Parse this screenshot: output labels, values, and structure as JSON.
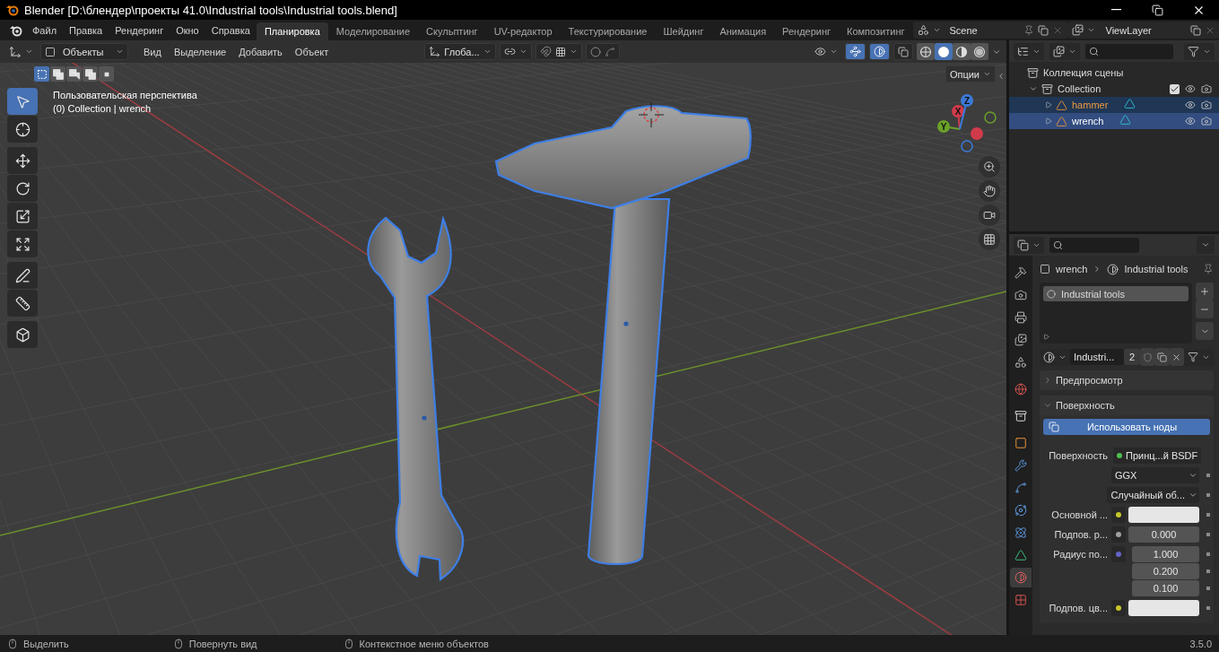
{
  "title_bar": {
    "title": "Blender [D:\\блендер\\проекты 41.0\\Industrial tools\\Industrial tools.blend]"
  },
  "top_bar": {
    "menus": [
      "Файл",
      "Правка",
      "Рендеринг",
      "Окно",
      "Справка"
    ],
    "workspaces": [
      {
        "label": "Планировка",
        "selected": true
      },
      {
        "label": "Моделирование",
        "selected": false
      },
      {
        "label": "Скульптинг",
        "selected": false
      },
      {
        "label": "UV-редактор",
        "selected": false
      },
      {
        "label": "Текстурирование",
        "selected": false
      },
      {
        "label": "Шейдинг",
        "selected": false
      },
      {
        "label": "Анимация",
        "selected": false
      },
      {
        "label": "Рендеринг",
        "selected": false
      },
      {
        "label": "Композитинг",
        "selected": false
      }
    ],
    "scene": "Scene",
    "view_layer": "ViewLayer"
  },
  "viewport": {
    "mode": "Объекты",
    "menus": [
      "Вид",
      "Выделение",
      "Добавить",
      "Объект"
    ],
    "orientation": "Глоба...",
    "toggles": [
      {
        "kind": "gizmos",
        "on": true
      },
      {
        "kind": "overlays",
        "on": true
      },
      {
        "kind": "xray",
        "on": false
      }
    ],
    "shading_modes": [
      {
        "kind": "wireframe",
        "selected": false
      },
      {
        "kind": "solid",
        "selected": true
      },
      {
        "kind": "material",
        "selected": false
      },
      {
        "kind": "rendered",
        "selected": false
      }
    ],
    "select_modes": [
      {
        "kind": "new",
        "selected": true
      },
      {
        "kind": "extend",
        "selected": false
      },
      {
        "kind": "subtract",
        "selected": false
      },
      {
        "kind": "invert",
        "selected": false
      },
      {
        "kind": "intersect",
        "selected": false
      }
    ],
    "options": "Опции",
    "tool_groups": [
      [
        {
          "kind": "select_box",
          "selected": true
        },
        {
          "kind": "cursor",
          "selected": false
        }
      ],
      [
        {
          "kind": "move",
          "selected": false
        },
        {
          "kind": "rotate",
          "selected": false
        },
        {
          "kind": "scale",
          "selected": false
        },
        {
          "kind": "transform",
          "selected": false
        }
      ],
      [
        {
          "kind": "annotate",
          "selected": false
        },
        {
          "kind": "measure",
          "selected": false
        }
      ],
      [
        {
          "kind": "add_cube",
          "selected": false
        }
      ]
    ],
    "view_name": "Пользовательская перспектива",
    "object_info": "(0) Collection | wrench",
    "gizmo_axes": [
      "X",
      "Y",
      "Z"
    ]
  },
  "outliner": {
    "root": "Коллекция сцены",
    "children": [
      {
        "name": "Collection",
        "expanded": true,
        "checked": true,
        "children": [
          {
            "name": "hammer",
            "expanded": false,
            "selected": true,
            "active": false
          },
          {
            "name": "wrench",
            "expanded": false,
            "selected": true,
            "active": true
          }
        ]
      }
    ]
  },
  "properties": {
    "tabs": [
      {
        "kind": "tool",
        "selected": false
      },
      {
        "kind": "render",
        "selected": false
      },
      {
        "kind": "output",
        "selected": false
      },
      {
        "kind": "view_layer",
        "selected": false
      },
      {
        "kind": "scene",
        "selected": false
      },
      {
        "kind": "world",
        "selected": false
      },
      {
        "kind": "collection",
        "selected": false
      },
      {
        "kind": "object",
        "selected": false
      },
      {
        "kind": "modifiers",
        "selected": false
      },
      {
        "kind": "particles",
        "selected": false
      },
      {
        "kind": "physics",
        "selected": false
      },
      {
        "kind": "constraints",
        "selected": false
      },
      {
        "kind": "data",
        "selected": false
      },
      {
        "kind": "material",
        "selected": true
      },
      {
        "kind": "texture",
        "selected": false
      }
    ],
    "object": "wrench",
    "material": "Industrial tools",
    "slots": [
      {
        "name": "Industrial tools",
        "selected": true
      }
    ],
    "material_name": "Industri...",
    "users": "2",
    "panels": [
      {
        "title": "Предпросмотр",
        "expanded": false
      },
      {
        "title": "Поверхность",
        "expanded": true,
        "use_nodes": "Использовать ноды",
        "rows": [
          {
            "kind": "link",
            "label": "Поверхность",
            "value": "Принц...й BSDF",
            "color": "#4fbf4f"
          },
          {
            "kind": "dropdown",
            "value": "GGX"
          },
          {
            "kind": "dropdown",
            "value": "Случайный об..."
          },
          {
            "kind": "color",
            "label": "Основной ...",
            "color": "#c7c729"
          },
          {
            "kind": "number",
            "label": "Подпов. р...",
            "value": "0.000",
            "color": "#a1a1a1"
          },
          {
            "kind": "vector",
            "label": "Радиус по...",
            "values": [
              "1.000",
              "0.200",
              "0.100"
            ],
            "color": "#6363c7"
          },
          {
            "kind": "color",
            "label": "Подпов. цв...",
            "color": "#c7c729"
          }
        ]
      }
    ]
  },
  "status_bar": {
    "hints": [
      "Выделить",
      "Повернуть вид",
      "Контекстное меню объектов"
    ],
    "version": "3.5.0"
  }
}
